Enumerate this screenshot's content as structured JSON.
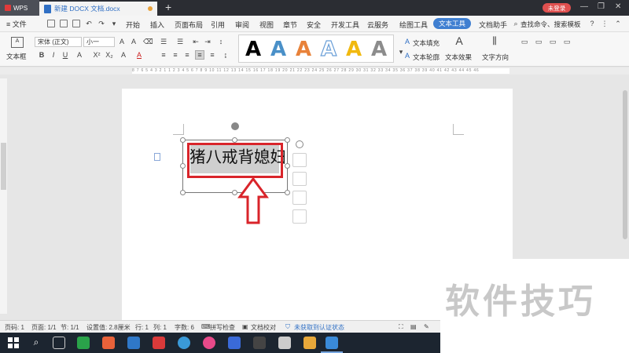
{
  "titlebar": {
    "app_tab": "WPS",
    "doc_tab": "新建 DOCX 文档.docx",
    "new_tab": "+",
    "login": "未登录"
  },
  "menubar": {
    "file": "≡ 文件",
    "items": [
      "开始",
      "插入",
      "页面布局",
      "引用",
      "审阅",
      "视图",
      "章节",
      "安全",
      "开发工具",
      "云服务",
      "绘图工具"
    ],
    "active": "文本工具",
    "extra": "文档助手",
    "search": "查找命令、搜索模板"
  },
  "toolbar": {
    "textbox_label": "文本框",
    "font_name": "宋体 (正文)",
    "font_size": "小一",
    "fill_label": "文本填充",
    "outline_label": "文本轮廓",
    "effect_label": "文本效果",
    "direction_label": "文字方向",
    "style_glyph": "A",
    "style_colors": [
      "#000000",
      "#4a90c8",
      "#e8823a",
      "#6a9fd8",
      "#f1b90f",
      "#8c8c8c"
    ]
  },
  "ruler": {
    "marks": "8 7 6 5 4 3 2 1  1 2 3 4 5 6 7 8 9 10 11 12 13 14 15 16 17 18 19 20 21 22 23 24 25 26 27 28 29 30 31 32 33 34 35 36 37 38 39 40 41 42 43 44 45 46"
  },
  "document": {
    "textbox_text": "猪八戒背媳妇"
  },
  "statusbar": {
    "page_num": "页码: 1",
    "page": "页面: 1/1",
    "section": "节: 1/1",
    "setting": "设置值: 2.8厘米",
    "row": "行: 1",
    "col": "列: 1",
    "words": "字数: 6",
    "spell": "拼写检查",
    "proof": "文档校对",
    "auth": "未获取到认证状态"
  },
  "watermark": {
    "text": "软件技巧"
  },
  "taskbar_colors": [
    "#2aa34a",
    "#e8623a",
    "#2f78c8",
    "#d93a3a",
    "#3a9ad8",
    "#e84a8a",
    "#3a6ad8",
    "#444444",
    "#cccccc",
    "#e8a83a",
    "#3a8ad8"
  ]
}
